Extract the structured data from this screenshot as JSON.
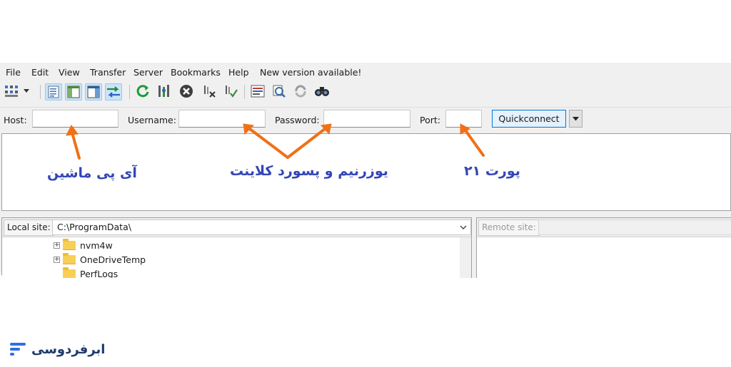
{
  "menu": [
    "File",
    "Edit",
    "View",
    "Transfer",
    "Server",
    "Bookmarks",
    "Help",
    "New version available!"
  ],
  "toolbar_icons": [
    "site-manager-icon",
    "dropdown-arrow-icon",
    "message-log-icon",
    "local-tree-icon",
    "remote-tree-icon",
    "transfer-queue-icon",
    "refresh-icon",
    "process-queue-icon",
    "cancel-icon",
    "disconnect-icon",
    "reconnect-icon",
    "directory-listing-filter-icon",
    "toggle-sync-browsing-icon",
    "directory-comparison-icon",
    "search-icon"
  ],
  "quickconnect": {
    "host_label": "Host:",
    "username_label": "Username:",
    "password_label": "Password:",
    "port_label": "Port:",
    "host_value": "",
    "username_value": "",
    "password_value": "",
    "port_value": "",
    "button_label": "Quickconnect"
  },
  "annotations": {
    "host_note": "آی پی ماشین",
    "credentials_note": "یوزرنیم و پسورد کلاینت",
    "port_note": "پورت ۲۱"
  },
  "local_site": {
    "label": "Local site:",
    "path": "C:\\ProgramData\\",
    "tree": [
      {
        "name": "nvm4w",
        "expandable": true
      },
      {
        "name": "OneDriveTemp",
        "expandable": true
      },
      {
        "name": "PerfLogs",
        "expandable": false
      }
    ]
  },
  "remote_site": {
    "label": "Remote site:",
    "path": ""
  },
  "brand": {
    "name": "ابرفردوسی"
  },
  "colors": {
    "annotation_text": "#3346b8",
    "arrow": "#f07018",
    "brand_text": "#1e3a6e",
    "brand_icon": "#2f6fe0"
  }
}
